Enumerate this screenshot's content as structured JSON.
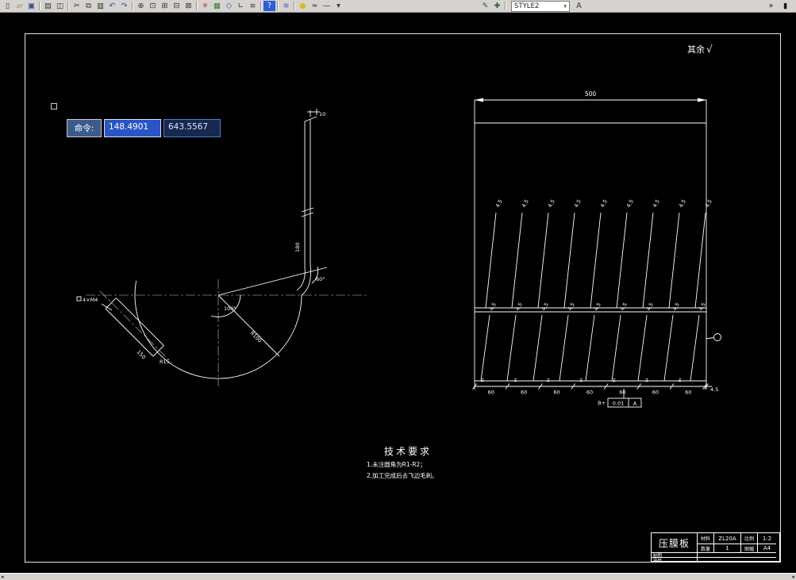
{
  "toolbar": {
    "icons": [
      {
        "name": "new-icon",
        "glyph": "▯",
        "color": "#333"
      },
      {
        "name": "open-icon",
        "glyph": "▱",
        "color": "#8a6d1f"
      },
      {
        "name": "save-icon",
        "glyph": "▣",
        "color": "#334d99"
      },
      {
        "sep": true
      },
      {
        "name": "print-icon",
        "glyph": "▤",
        "color": "#333"
      },
      {
        "name": "print-preview-icon",
        "glyph": "◫",
        "color": "#333"
      },
      {
        "sep": true
      },
      {
        "name": "cut-icon",
        "glyph": "✂",
        "color": "#333"
      },
      {
        "name": "copy-icon",
        "glyph": "⧉",
        "color": "#333"
      },
      {
        "name": "paste-icon",
        "glyph": "▥",
        "color": "#333"
      },
      {
        "name": "undo-icon",
        "glyph": "↶",
        "color": "#2b4fbf"
      },
      {
        "name": "redo-icon",
        "glyph": "↷",
        "color": "#2b4fbf"
      },
      {
        "sep": true
      },
      {
        "name": "zoom-realtime-icon",
        "glyph": "⊕",
        "color": "#333"
      },
      {
        "name": "zoom-window-icon",
        "glyph": "⊡",
        "color": "#333"
      },
      {
        "name": "zoom-in-icon",
        "glyph": "⊞",
        "color": "#333"
      },
      {
        "name": "zoom-out-icon",
        "glyph": "⊟",
        "color": "#333"
      },
      {
        "name": "zoom-extents-icon",
        "glyph": "⊠",
        "color": "#333"
      },
      {
        "sep": true
      },
      {
        "name": "redraw-icon",
        "glyph": "✳",
        "color": "#a33"
      },
      {
        "name": "grid-icon",
        "glyph": "▦",
        "color": "#2e7d32"
      },
      {
        "name": "osnap-icon",
        "glyph": "◇",
        "color": "#2b4fbf"
      },
      {
        "name": "ortho-icon",
        "glyph": "∟",
        "color": "#333"
      },
      {
        "name": "layers-icon",
        "glyph": "≡",
        "color": "#333"
      },
      {
        "sep": true
      },
      {
        "name": "help-icon",
        "glyph": "?",
        "color": "#fff",
        "bg": "#2b5fd9"
      },
      {
        "sep": true
      },
      {
        "name": "sheet-set-icon",
        "glyph": "≋",
        "color": "#2b5fd9"
      },
      {
        "sep": true
      },
      {
        "name": "color-control-icon",
        "glyph": "●",
        "color": "#d9b916"
      },
      {
        "name": "linetype-icon",
        "glyph": "≈",
        "color": "#333"
      },
      {
        "name": "lineweight-icon",
        "glyph": "—",
        "color": "#333"
      },
      {
        "name": "properties-dropdown-icon",
        "glyph": "▾",
        "color": "#333"
      },
      {
        "spacer": 170
      },
      {
        "name": "draw-toolbar-icon",
        "glyph": "✎",
        "color": "#335c33"
      },
      {
        "name": "modify-toolbar-icon",
        "glyph": "✚",
        "color": "#335c33"
      },
      {
        "sep": true
      }
    ],
    "style_value": "STYLE2",
    "after_icons": [
      {
        "name": "text-style-icon",
        "glyph": "A",
        "color": "#333"
      }
    ],
    "right_icons": [
      {
        "name": "overflow-icon",
        "glyph": "»",
        "color": "#111"
      },
      {
        "name": "drag-handle-icon",
        "glyph": "▮",
        "color": "#111"
      }
    ]
  },
  "command": {
    "label": "命令:",
    "x_value": "148.4901",
    "y_value": "643.5567"
  },
  "left_view": {
    "dim_top": "10",
    "dim_height": "180",
    "angle_center": "100°",
    "angle_top": "60°",
    "radius_label": "R100",
    "tab_length": "150",
    "tab_radius": "R15",
    "tab_callout": "4×M4"
  },
  "right_view": {
    "dim_total": "500",
    "upper_labels": [
      "4.5",
      "4.5",
      "4.5",
      "4.5",
      "4.5",
      "4.5",
      "4.5",
      "4.5",
      "4.5"
    ],
    "lower_labels": [
      "4.5",
      "4.5",
      "4.5",
      "4.5",
      "4.5",
      "4.5",
      "4.5",
      "4.5",
      "4.5"
    ],
    "pitch_labels": [
      "60",
      "60",
      "60",
      "60",
      "60",
      "60",
      "60"
    ],
    "tick_letters": [
      "Z",
      "Z",
      "Z",
      "Z",
      "Z",
      "Z",
      "Z"
    ],
    "end_dim": "4.5",
    "gdt_prefix": "B+",
    "gdt_tolerance": "0.01",
    "gdt_datum": "A"
  },
  "annotations": {
    "surface_text": "其余",
    "surface_symbol": "√",
    "tech_title": "技术要求",
    "tech_items": [
      "1.未注圆角为R1-R2；",
      "2.加工完成后去飞边毛刺。"
    ]
  },
  "title_block": {
    "part_name": "压膜板",
    "fields": [
      {
        "label": "材料",
        "value": "ZL20A"
      },
      {
        "label": "比例",
        "value": "1:2"
      },
      {
        "label": "数量",
        "value": "1"
      },
      {
        "label": "图幅",
        "value": "A4"
      }
    ],
    "sign_rows": [
      "制图",
      "审核"
    ],
    "scroll_left": "◂",
    "scroll_right": "▸"
  }
}
